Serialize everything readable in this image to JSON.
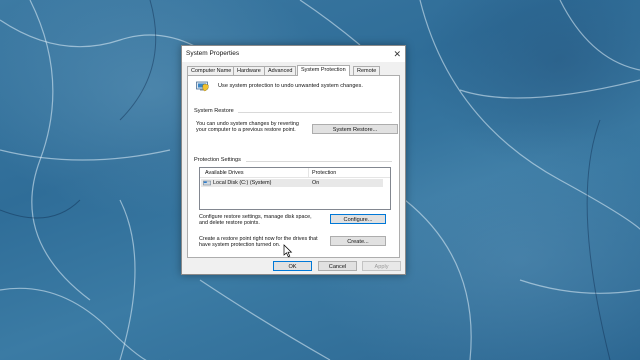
{
  "window": {
    "title": "System Properties",
    "close_glyph": "✕"
  },
  "tabs": [
    {
      "label": "Computer Name"
    },
    {
      "label": "Hardware"
    },
    {
      "label": "Advanced"
    },
    {
      "label": "System Protection",
      "active": true
    },
    {
      "label": "Remote"
    }
  ],
  "header": {
    "icon": "shield-icon",
    "description": "Use system protection to undo unwanted system changes."
  },
  "system_restore": {
    "group_label": "System Restore",
    "text_line1": "You can undo system changes by reverting",
    "text_line2": "your computer to a previous restore point.",
    "button_label": "System Restore..."
  },
  "protection_settings": {
    "group_label": "Protection Settings",
    "columns": [
      "Available Drives",
      "Protection"
    ],
    "drives": [
      {
        "name": "Local Disk (C:) (System)",
        "protection": "On",
        "icon": "drive-icon"
      }
    ],
    "configure_text_line1": "Configure restore settings, manage disk space,",
    "configure_text_line2": "and delete restore points.",
    "configure_button": "Configure...",
    "create_text_line1": "Create a restore point right now for the drives that",
    "create_text_line2": "have system protection turned on.",
    "create_button": "Create..."
  },
  "footer": {
    "ok": "OK",
    "cancel": "Cancel",
    "apply": "Apply"
  },
  "colors": {
    "accent_focus": "#0078d7",
    "dialog_bg": "#f0f0f0",
    "desktop_blue": "#2f6d98"
  }
}
